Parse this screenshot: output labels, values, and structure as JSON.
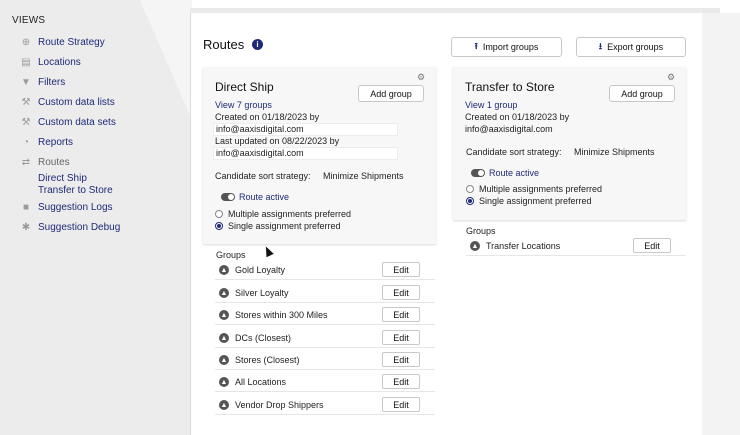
{
  "sidebar": {
    "heading": "VIEWS",
    "items": [
      {
        "label": "Route Strategy",
        "icon": "globe-icon"
      },
      {
        "label": "Locations",
        "icon": "building-icon"
      },
      {
        "label": "Filters",
        "icon": "funnel-icon"
      },
      {
        "label": "Custom data lists",
        "icon": "wrench-icon"
      },
      {
        "label": "Custom data sets",
        "icon": "wrench-icon"
      },
      {
        "label": "Reports",
        "icon": "pie-chart-icon"
      },
      {
        "label": "Routes",
        "icon": "shuffle-icon"
      }
    ],
    "route_children": [
      "Direct Ship",
      "Transfer to Store"
    ],
    "items_after": [
      {
        "label": "Suggestion Logs",
        "icon": "log-icon"
      },
      {
        "label": "Suggestion Debug",
        "icon": "bug-icon"
      }
    ]
  },
  "header": {
    "title": "Routes",
    "info_icon": "i",
    "import_label": "Import groups",
    "export_label": "Export groups"
  },
  "cards": [
    {
      "title": "Direct Ship",
      "view_link": "View 7 groups",
      "created": "Created on 01/18/2023 by",
      "created_by": "info@aaxisdigital.com",
      "updated": "Last updated on 08/22/2023 by",
      "updated_by": "info@aaxisdigital.com",
      "add_group_label": "Add group",
      "sort_strategy_label": "Candidate sort strategy:",
      "sort_strategy_value": "Minimize Shipments",
      "route_active_label": "Route active",
      "radio_multiple": "Multiple assignments preferred",
      "radio_single": "Single assignment preferred",
      "selected": "single",
      "groups_label": "Groups",
      "groups": [
        {
          "name": "Gold Loyalty",
          "edit": "Edit"
        },
        {
          "name": "Silver Loyalty",
          "edit": "Edit"
        },
        {
          "name": "Stores within 300 Miles",
          "edit": "Edit"
        },
        {
          "name": "DCs (Closest)",
          "edit": "Edit"
        },
        {
          "name": "Stores (Closest)",
          "edit": "Edit"
        },
        {
          "name": "All Locations",
          "edit": "Edit"
        },
        {
          "name": "Vendor Drop Shippers",
          "edit": "Edit"
        }
      ]
    },
    {
      "title": "Transfer to Store",
      "view_link": "View 1 group",
      "created": "Created on 01/18/2023 by",
      "created_by": "info@aaxisdigital.com",
      "add_group_label": "Add group",
      "sort_strategy_label": "Candidate sort strategy:",
      "sort_strategy_value": "Minimize Shipments",
      "route_active_label": "Route active",
      "radio_multiple": "Multiple assignments preferred",
      "radio_single": "Single assignment preferred",
      "selected": "single",
      "groups_label": "Groups",
      "groups": [
        {
          "name": "Transfer Locations",
          "edit": "Edit"
        }
      ]
    }
  ],
  "colors": {
    "accent": "#1e2a78",
    "sidebar_bg": "#ececec",
    "card_bg": "#f7f7f7"
  }
}
